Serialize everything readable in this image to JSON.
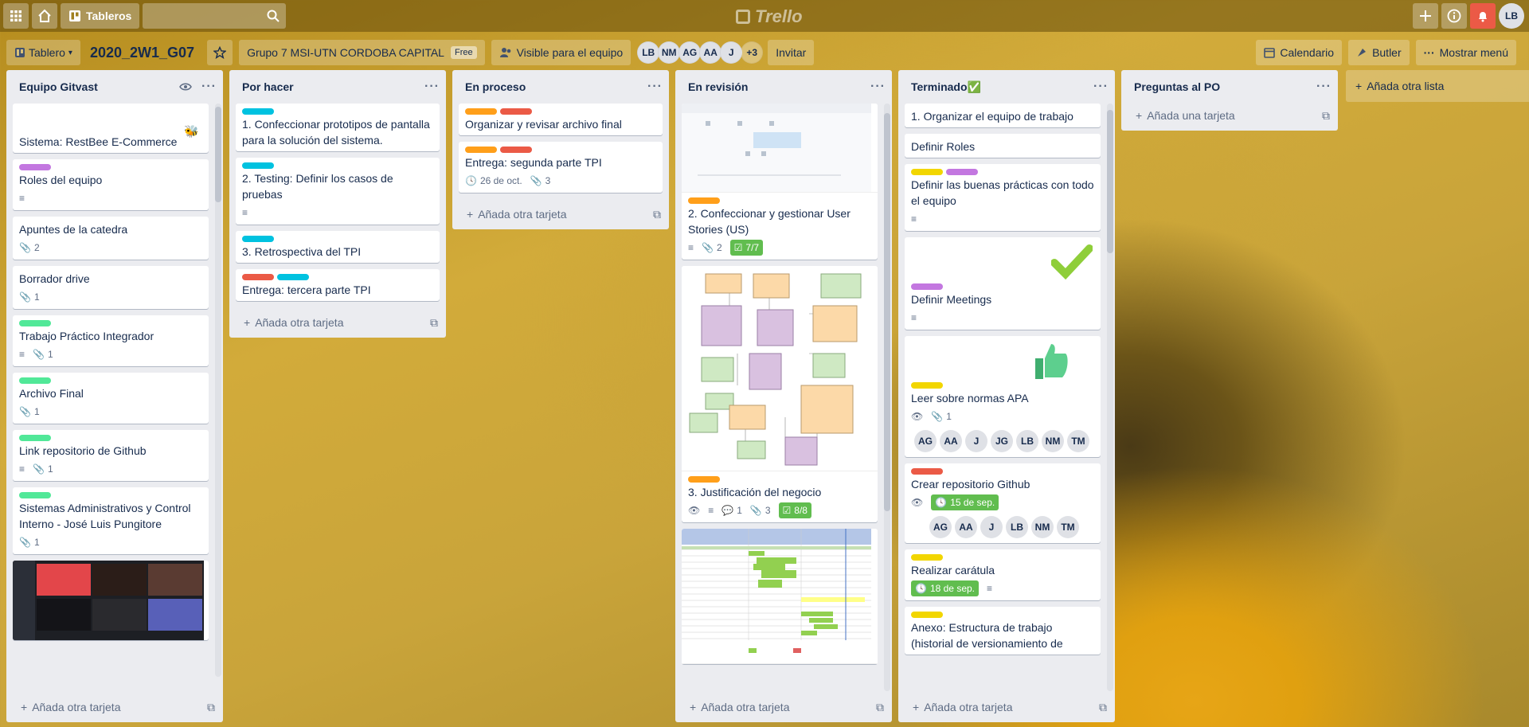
{
  "topbar": {
    "boards_label": "Tableros",
    "logo": "Trello",
    "avatar": "LB"
  },
  "boardbar": {
    "view_label": "Tablero",
    "board_name": "2020_2W1_G07",
    "team": "Grupo 7 MSI-UTN CORDOBA CAPITAL",
    "plan": "Free",
    "visibility": "Visible para el equipo",
    "members": [
      "LB",
      "NM",
      "AG",
      "AA",
      "J"
    ],
    "more_members": "+3",
    "invite": "Invitar",
    "calendar": "Calendario",
    "butler": "Butler",
    "menu": "Mostrar menú"
  },
  "colors": {
    "green": "#61bd4f",
    "yellow": "#f2d600",
    "orange": "#ff9f1a",
    "red": "#eb5a46",
    "purple": "#c377e0",
    "sky": "#00c2e0",
    "lime": "#51e898"
  },
  "lists": [
    {
      "name": "Equipo Gitvast",
      "footer": "Añada otra tarjeta",
      "cards": [
        {
          "title": "Sistema: RestBee E-Commerce",
          "cover_icon": "bee-icon"
        },
        {
          "title": "Roles del equipo",
          "labels": [
            "purple"
          ],
          "desc": true
        },
        {
          "title": "Apuntes de la catedra",
          "attach": "2"
        },
        {
          "title": "Borrador drive",
          "attach": "1"
        },
        {
          "title": "Trabajo Práctico Integrador",
          "labels": [
            "lime"
          ],
          "desc": true,
          "attach": "1"
        },
        {
          "title": "Archivo Final",
          "labels": [
            "lime"
          ],
          "attach": "1"
        },
        {
          "title": "Link repositorio de Github",
          "labels": [
            "lime"
          ],
          "desc": true,
          "attach": "1"
        },
        {
          "title": "Sistemas Administrativos y Control Interno - José Luis Pungitore",
          "labels": [
            "lime"
          ],
          "attach": "1"
        }
      ]
    },
    {
      "name": "Por hacer",
      "footer": "Añada otra tarjeta",
      "cards": [
        {
          "title": "1. Confeccionar prototipos de pantalla para la solución del sistema.",
          "labels": [
            "sky"
          ]
        },
        {
          "title": "2. Testing: Definir los casos de pruebas",
          "labels": [
            "sky"
          ],
          "desc": true
        },
        {
          "title": "3. Retrospectiva del TPI",
          "labels": [
            "sky"
          ]
        },
        {
          "title": "Entrega: tercera parte TPI",
          "labels": [
            "red",
            "sky"
          ]
        }
      ]
    },
    {
      "name": "En proceso",
      "footer": "Añada otra tarjeta",
      "cards": [
        {
          "title": "Organizar y revisar archivo final",
          "labels": [
            "orange",
            "red"
          ]
        },
        {
          "title": "Entrega: segunda parte TPI",
          "labels": [
            "orange",
            "red"
          ],
          "date": "26 de oct.",
          "attach": "3"
        }
      ]
    },
    {
      "name": "En revisión",
      "footer": "Añada otra tarjeta",
      "cards": [
        {
          "title": "2. Confeccionar y gestionar User Stories (US)",
          "labels": [
            "orange"
          ],
          "attach": "2",
          "check": "7/7"
        },
        {
          "title": "3. Justificación del negocio",
          "labels": [
            "orange"
          ],
          "comments": "1",
          "attach": "3",
          "check": "8/8"
        }
      ]
    },
    {
      "name": "Terminado✅",
      "footer": "Añada otra tarjeta",
      "cards": [
        {
          "title": "1. Organizar el equipo de trabajo"
        },
        {
          "title": "Definir Roles"
        },
        {
          "title": "Definir las buenas prácticas con todo el equipo",
          "labels": [
            "yellow",
            "purple"
          ]
        },
        {
          "title": "Definir Meetings",
          "labels": [
            "purple"
          ]
        },
        {
          "title": "Leer sobre normas APA",
          "labels": [
            "yellow"
          ],
          "attach": "1",
          "members": [
            "AG",
            "AA",
            "J",
            "JG",
            "LB",
            "NM",
            "TM"
          ]
        },
        {
          "title": "Crear repositorio Github",
          "labels": [
            "red"
          ],
          "date": "15 de sep.",
          "members": [
            "AG",
            "AA",
            "J",
            "LB",
            "NM",
            "TM"
          ]
        },
        {
          "title": "Realizar carátula",
          "labels": [
            "yellow"
          ],
          "date": "18 de sep."
        },
        {
          "title": "Anexo: Estructura de trabajo (historial de versionamiento de",
          "labels": [
            "yellow"
          ]
        }
      ]
    },
    {
      "name": "Preguntas al PO",
      "footer": "Añada una tarjeta",
      "cards": []
    }
  ],
  "add_list": "Añada otra lista"
}
